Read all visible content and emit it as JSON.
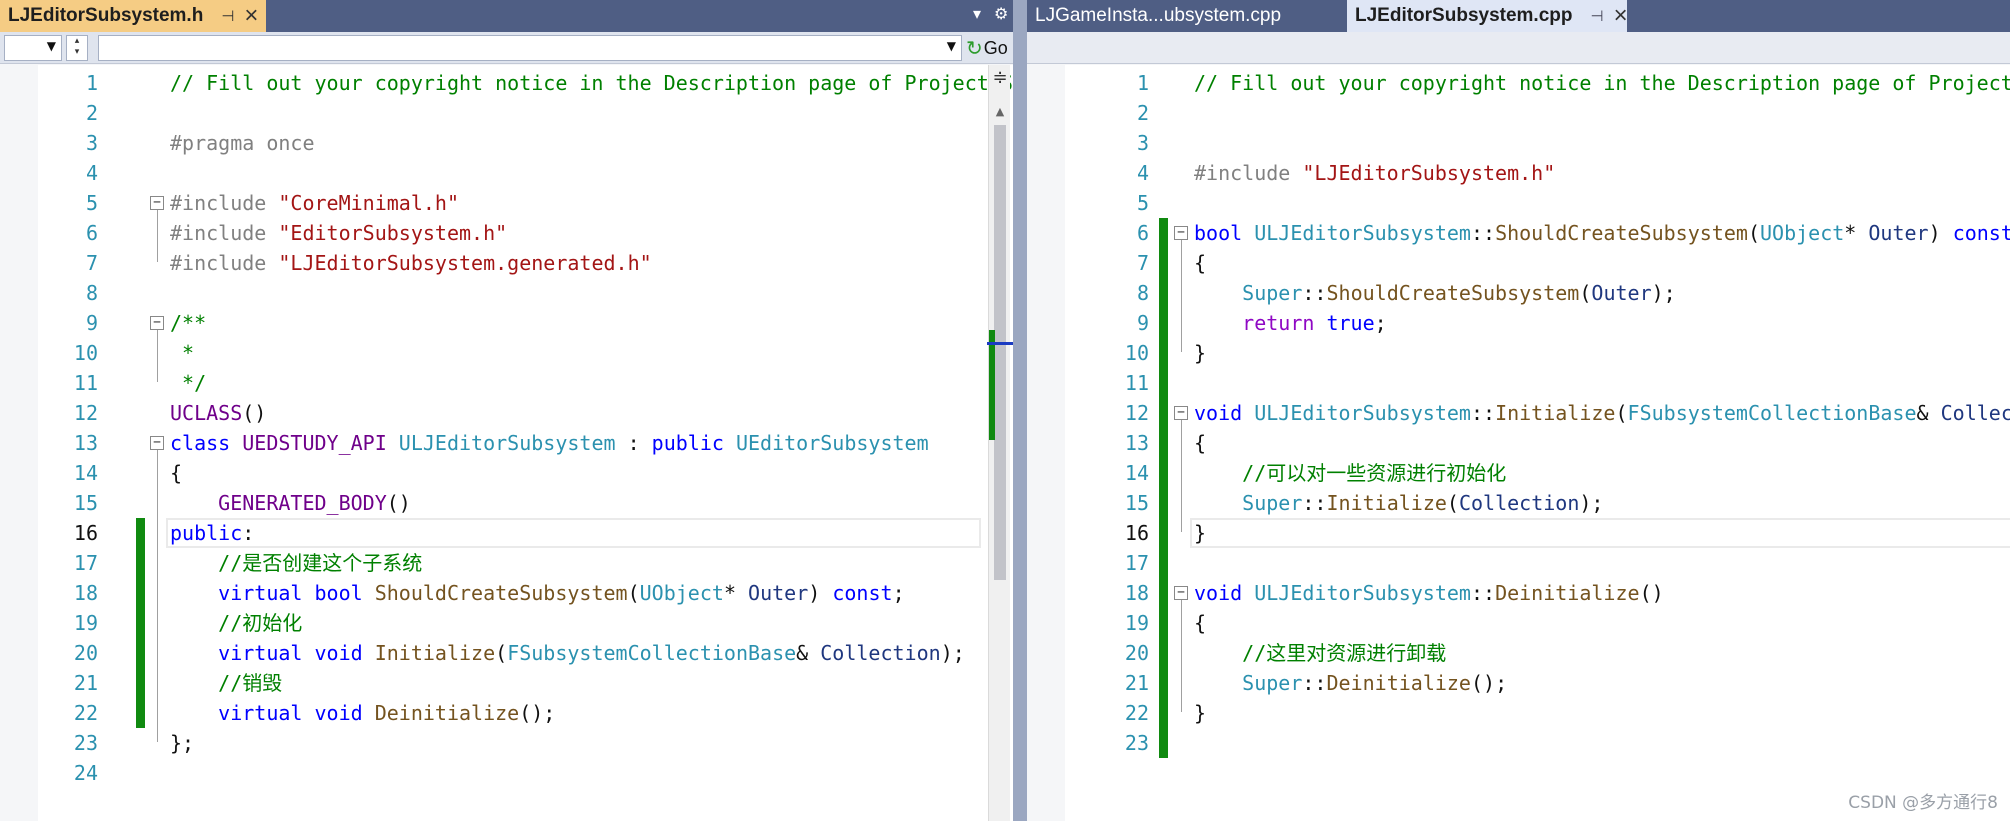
{
  "left": {
    "tabs": [
      {
        "label": "LJEditorSubsystem.h",
        "pin": "⊣",
        "close": "×"
      }
    ],
    "nav": {
      "go_label": "Go"
    },
    "current_line": 16,
    "lines": [
      {
        "n": 1,
        "segs": [
          [
            "com",
            "// Fill out your copyright notice in the Description page of Project Settings."
          ]
        ]
      },
      {
        "n": 2,
        "segs": []
      },
      {
        "n": 3,
        "segs": [
          [
            "pp",
            "#pragma once"
          ]
        ]
      },
      {
        "n": 4,
        "segs": []
      },
      {
        "n": 5,
        "segs": [
          [
            "pp",
            "#include "
          ],
          [
            "str",
            "\"CoreMinimal.h\""
          ]
        ]
      },
      {
        "n": 6,
        "segs": [
          [
            "pp",
            "#include "
          ],
          [
            "str",
            "\"EditorSubsystem.h\""
          ]
        ]
      },
      {
        "n": 7,
        "segs": [
          [
            "pp",
            "#include "
          ],
          [
            "str",
            "\"LJEditorSubsystem.generated.h\""
          ]
        ]
      },
      {
        "n": 8,
        "segs": []
      },
      {
        "n": 9,
        "segs": [
          [
            "com",
            "/**"
          ]
        ]
      },
      {
        "n": 10,
        "segs": [
          [
            "com",
            " *"
          ]
        ]
      },
      {
        "n": 11,
        "segs": [
          [
            "com",
            " */"
          ]
        ]
      },
      {
        "n": 12,
        "segs": [
          [
            "mac",
            "UCLASS"
          ],
          [
            "",
            "()"
          ]
        ]
      },
      {
        "n": 13,
        "segs": [
          [
            "kw",
            "class "
          ],
          [
            "mac",
            "UEDSTUDY_API "
          ],
          [
            "type",
            "ULJEditorSubsystem"
          ],
          [
            "",
            " : "
          ],
          [
            "kw",
            "public "
          ],
          [
            "type",
            "UEditorSubsystem"
          ]
        ]
      },
      {
        "n": 14,
        "segs": [
          [
            "",
            "{"
          ]
        ]
      },
      {
        "n": 15,
        "segs": [
          [
            "",
            "    "
          ],
          [
            "mac",
            "GENERATED_BODY"
          ],
          [
            "",
            "()"
          ]
        ]
      },
      {
        "n": 16,
        "segs": [
          [
            "kw",
            "public"
          ],
          [
            "",
            ":"
          ]
        ]
      },
      {
        "n": 17,
        "segs": [
          [
            "",
            "    "
          ],
          [
            "com",
            "//是否创建这个子系统"
          ]
        ]
      },
      {
        "n": 18,
        "segs": [
          [
            "",
            "    "
          ],
          [
            "kw",
            "virtual bool "
          ],
          [
            "fn",
            "ShouldCreateSubsystem"
          ],
          [
            "",
            "("
          ],
          [
            "type",
            "UObject"
          ],
          [
            "",
            "* "
          ],
          [
            "var",
            "Outer"
          ],
          [
            "",
            ") "
          ],
          [
            "kw",
            "const"
          ],
          [
            "",
            ";"
          ]
        ]
      },
      {
        "n": 19,
        "segs": [
          [
            "",
            "    "
          ],
          [
            "com",
            "//初始化"
          ]
        ]
      },
      {
        "n": 20,
        "segs": [
          [
            "",
            "    "
          ],
          [
            "kw",
            "virtual void "
          ],
          [
            "fn",
            "Initialize"
          ],
          [
            "",
            "("
          ],
          [
            "type",
            "FSubsystemCollectionBase"
          ],
          [
            "",
            "& "
          ],
          [
            "var",
            "Collection"
          ],
          [
            "",
            ");"
          ]
        ]
      },
      {
        "n": 21,
        "segs": [
          [
            "",
            "    "
          ],
          [
            "com",
            "//销毁"
          ]
        ]
      },
      {
        "n": 22,
        "segs": [
          [
            "",
            "    "
          ],
          [
            "kw",
            "virtual void "
          ],
          [
            "fn",
            "Deinitialize"
          ],
          [
            "",
            "();"
          ]
        ]
      },
      {
        "n": 23,
        "segs": [
          [
            "",
            "};"
          ]
        ]
      },
      {
        "n": 24,
        "segs": []
      }
    ]
  },
  "right": {
    "tabs": [
      {
        "label": "LJGameInsta...ubsystem.cpp"
      },
      {
        "label": "LJEditorSubsystem.cpp",
        "pin": "⊣",
        "close": "×"
      }
    ],
    "current_line": 16,
    "lines": [
      {
        "n": 1,
        "segs": [
          [
            "com",
            "// Fill out your copyright notice in the Description page of Project Settings."
          ]
        ]
      },
      {
        "n": 2,
        "segs": []
      },
      {
        "n": 3,
        "segs": []
      },
      {
        "n": 4,
        "segs": [
          [
            "pp",
            "#include "
          ],
          [
            "str",
            "\"LJEditorSubsystem.h\""
          ]
        ]
      },
      {
        "n": 5,
        "segs": []
      },
      {
        "n": 6,
        "segs": [
          [
            "kw",
            "bool "
          ],
          [
            "type",
            "ULJEditorSubsystem"
          ],
          [
            "",
            "::"
          ],
          [
            "fn",
            "ShouldCreateSubsystem"
          ],
          [
            "",
            "("
          ],
          [
            "type",
            "UObject"
          ],
          [
            "",
            "* "
          ],
          [
            "var",
            "Outer"
          ],
          [
            "",
            ") "
          ],
          [
            "kw",
            "const"
          ]
        ]
      },
      {
        "n": 7,
        "segs": [
          [
            "",
            "{"
          ]
        ]
      },
      {
        "n": 8,
        "segs": [
          [
            "",
            "    "
          ],
          [
            "type",
            "Super"
          ],
          [
            "",
            "::"
          ],
          [
            "fn",
            "ShouldCreateSubsystem"
          ],
          [
            "",
            "("
          ],
          [
            "var",
            "Outer"
          ],
          [
            "",
            ");"
          ]
        ]
      },
      {
        "n": 9,
        "segs": [
          [
            "",
            "    "
          ],
          [
            "kw2",
            "return "
          ],
          [
            "kw",
            "true"
          ],
          [
            "",
            ";"
          ]
        ]
      },
      {
        "n": 10,
        "segs": [
          [
            "",
            "}"
          ]
        ]
      },
      {
        "n": 11,
        "segs": []
      },
      {
        "n": 12,
        "segs": [
          [
            "kw",
            "void "
          ],
          [
            "type",
            "ULJEditorSubsystem"
          ],
          [
            "",
            "::"
          ],
          [
            "fn",
            "Initialize"
          ],
          [
            "",
            "("
          ],
          [
            "type",
            "FSubsystemCollectionBase"
          ],
          [
            "",
            "& "
          ],
          [
            "var",
            "Collection"
          ],
          [
            "",
            ")"
          ]
        ]
      },
      {
        "n": 13,
        "segs": [
          [
            "",
            "{"
          ]
        ]
      },
      {
        "n": 14,
        "segs": [
          [
            "",
            "    "
          ],
          [
            "com",
            "//可以对一些资源进行初始化"
          ]
        ]
      },
      {
        "n": 15,
        "segs": [
          [
            "",
            "    "
          ],
          [
            "type",
            "Super"
          ],
          [
            "",
            "::"
          ],
          [
            "fn",
            "Initialize"
          ],
          [
            "",
            "("
          ],
          [
            "var",
            "Collection"
          ],
          [
            "",
            ");"
          ]
        ]
      },
      {
        "n": 16,
        "segs": [
          [
            "",
            "}"
          ]
        ]
      },
      {
        "n": 17,
        "segs": []
      },
      {
        "n": 18,
        "segs": [
          [
            "kw",
            "void "
          ],
          [
            "type",
            "ULJEditorSubsystem"
          ],
          [
            "",
            "::"
          ],
          [
            "fn",
            "Deinitialize"
          ],
          [
            "",
            "()"
          ]
        ]
      },
      {
        "n": 19,
        "segs": [
          [
            "",
            "{"
          ]
        ]
      },
      {
        "n": 20,
        "segs": [
          [
            "",
            "    "
          ],
          [
            "com",
            "//这里对资源进行卸载"
          ]
        ]
      },
      {
        "n": 21,
        "segs": [
          [
            "",
            "    "
          ],
          [
            "type",
            "Super"
          ],
          [
            "",
            "::"
          ],
          [
            "fn",
            "Deinitialize"
          ],
          [
            "",
            "();"
          ]
        ]
      },
      {
        "n": 22,
        "segs": [
          [
            "",
            "}"
          ]
        ]
      },
      {
        "n": 23,
        "segs": []
      }
    ]
  },
  "watermark": "CSDN @多方通行8",
  "icons": {
    "dropdown": "chevron-down-icon",
    "settings": "gear-icon",
    "go": "go-arrow-icon",
    "split": "split-icon"
  },
  "colors": {
    "tab_active": "#f5cc84",
    "tab_bar": "#4f5e84",
    "comment": "#008000",
    "keyword": "#0000ff",
    "type": "#2b91af",
    "string": "#a31515",
    "function": "#74531f",
    "macro": "#6f008a",
    "change_marker": "#108a10"
  }
}
